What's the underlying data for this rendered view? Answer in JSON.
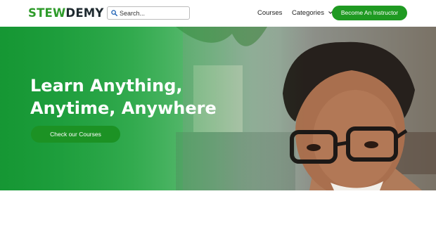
{
  "brand": {
    "part1": "STEW",
    "part2": "DEMY"
  },
  "search": {
    "placeholder": "Search..."
  },
  "nav": {
    "courses_label": "Courses",
    "categories_label": "Categories",
    "instructor_label": "Become An Instructor"
  },
  "hero": {
    "title_line1": "Learn Anything,",
    "title_line2": "Anytime, Anywhere",
    "cta_label": "Check our Courses"
  },
  "icons": {
    "search": "search-icon",
    "categories_chevron": "chevron-down-icon"
  },
  "colors": {
    "brand_green": "#2e9b2a",
    "brand_dark": "#1f2a30",
    "button_green": "#1f9a22",
    "hero_green": "#2aa94a"
  }
}
